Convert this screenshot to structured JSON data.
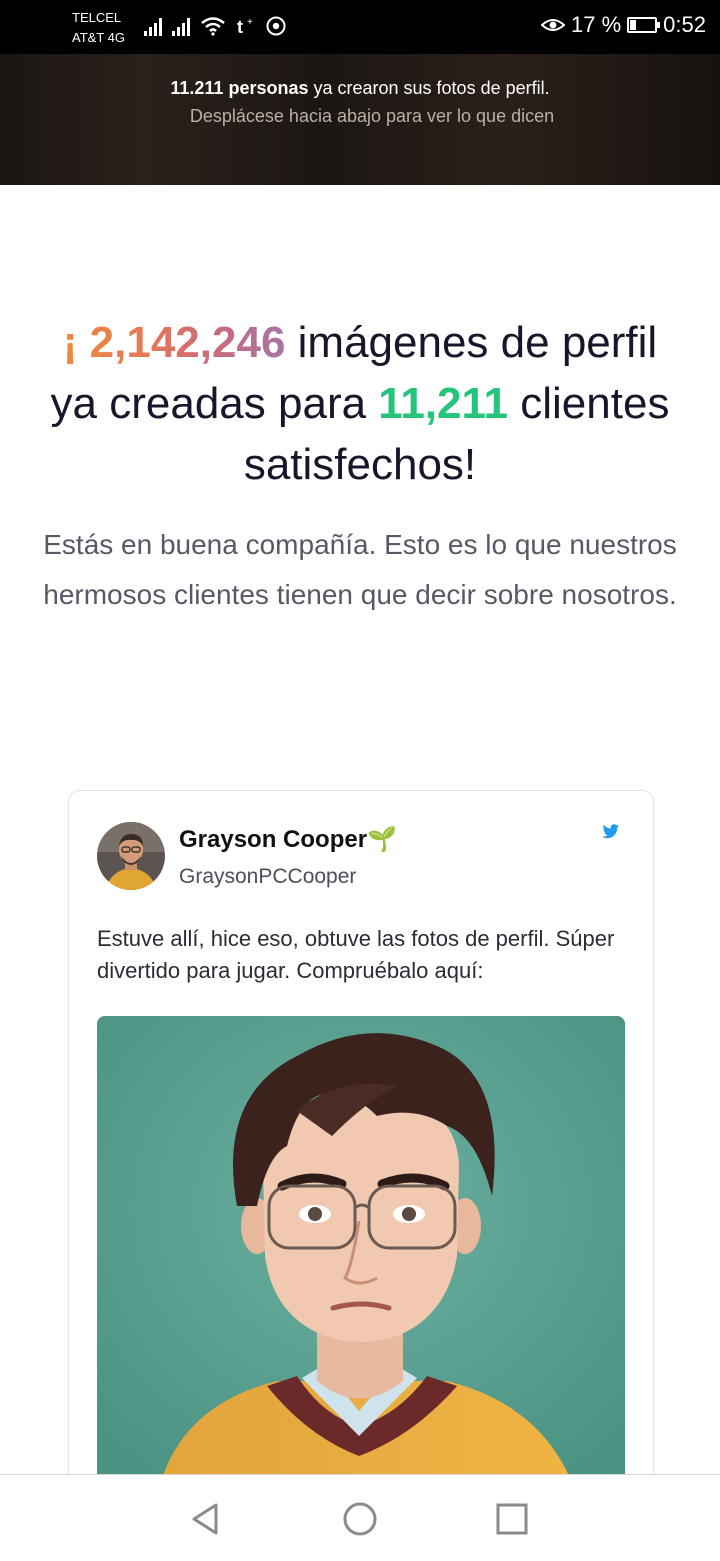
{
  "status_bar": {
    "carrier1": "TELCEL",
    "carrier2": "AT&T 4G",
    "battery": "17 %",
    "time": "0:52",
    "icons": [
      "signal-icon",
      "signal-icon",
      "wifi-icon",
      "t-plus-icon",
      "chrome-icon",
      "eye-icon",
      "battery-icon"
    ]
  },
  "banner": {
    "count": "11.211 personas",
    "line1_rest": " ya crearon sus fotos de perfil.",
    "line2": "Desplácese hacia abajo para ver lo que dicen"
  },
  "headline": {
    "prefix": "¡ 2,142,246",
    "mid": " imágenes de perfil ya creadas para ",
    "clients": "11,211",
    "suffix": " clientes satisfechos!"
  },
  "subtitle": "Estás en buena compañía. Esto es lo que nuestros hermosos clientes tienen que decir sobre nosotros.",
  "tweet": {
    "name": "Grayson Cooper🌱",
    "handle": "GraysonPCCooper",
    "text": "Estuve allí, hice eso, obtuve las fotos de perfil. Súper divertido para jugar. Compruébalo aquí:",
    "icon": "twitter-icon"
  },
  "colors": {
    "accent_gradient": [
      "#f08a3b",
      "#a974a6"
    ],
    "clients_green": "#24c47a",
    "twitter_blue": "#1d9bf0"
  }
}
